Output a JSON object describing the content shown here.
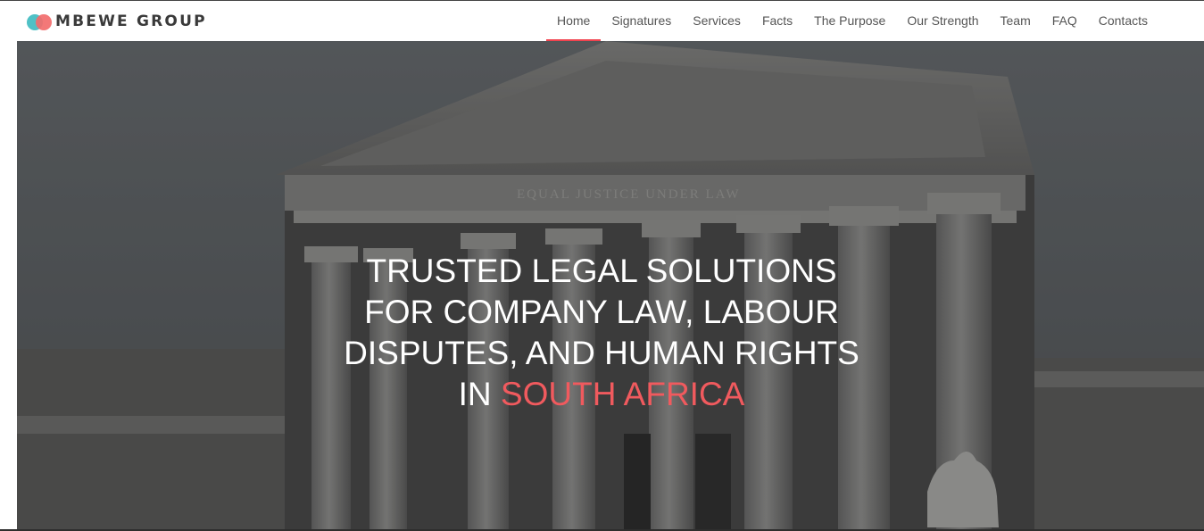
{
  "brand": {
    "name": "MBEWE GROUP"
  },
  "nav": {
    "items": [
      {
        "label": "Home",
        "active": true
      },
      {
        "label": "Signatures"
      },
      {
        "label": "Services"
      },
      {
        "label": "Facts"
      },
      {
        "label": "The Purpose"
      },
      {
        "label": "Our Strength"
      },
      {
        "label": "Team"
      },
      {
        "label": "FAQ"
      },
      {
        "label": "Contacts"
      }
    ]
  },
  "hero": {
    "line1": "TRUSTED LEGAL SOLUTIONS",
    "line2": "FOR COMPANY LAW, LABOUR",
    "line3": "DISPUTES, AND HUMAN RIGHTS",
    "line4_prefix": "IN",
    "line4_accent": "SOUTH AFRICA",
    "inscription": "EQUAL JUSTICE UNDER LAW"
  },
  "colors": {
    "accent": "#f05a5e",
    "logo_teal": "#4fc1c6",
    "logo_coral": "#f26d6d",
    "nav_active_underline": "#f0434f"
  }
}
